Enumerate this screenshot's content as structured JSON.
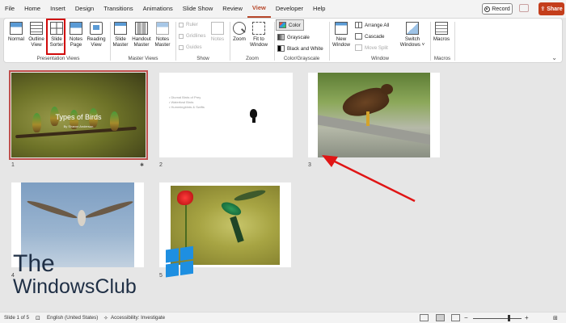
{
  "tabs": [
    "File",
    "Home",
    "Insert",
    "Design",
    "Transitions",
    "Animations",
    "Slide Show",
    "Review",
    "View",
    "Developer",
    "Help"
  ],
  "active_tab": "View",
  "header": {
    "record_label": "Record",
    "share_label": "Share"
  },
  "ribbon": {
    "presentation_views": {
      "label": "Presentation Views",
      "normal": "Normal",
      "outline": [
        "Outline",
        "View"
      ],
      "sorter": [
        "Slide",
        "Sorter"
      ],
      "notes": [
        "Notes",
        "Page"
      ],
      "reading": [
        "Reading",
        "View"
      ]
    },
    "master_views": {
      "label": "Master Views",
      "slide_master": [
        "Slide",
        "Master"
      ],
      "handout_master": [
        "Handout",
        "Master"
      ],
      "notes_master": [
        "Notes",
        "Master"
      ]
    },
    "show": {
      "label": "Show",
      "ruler": "Ruler",
      "gridlines": "Gridlines",
      "guides": "Guides",
      "notes": "Notes"
    },
    "zoom": {
      "label": "Zoom",
      "zoom": "Zoom",
      "fit": [
        "Fit to",
        "Window"
      ]
    },
    "color": {
      "label": "Color/Grayscale",
      "color": "Color",
      "grayscale": "Grayscale",
      "bw": "Black and White"
    },
    "window": {
      "label": "Window",
      "new_window": [
        "New",
        "Window"
      ],
      "arrange_all": "Arrange All",
      "cascade": "Cascade",
      "move_split": "Move Split",
      "switch": [
        "Switch",
        "Windows ˅"
      ]
    },
    "macros": {
      "label": "Macros",
      "macros": "Macros"
    }
  },
  "slides": [
    {
      "number": "1",
      "title": "Types of Birds",
      "subtitle": "By Sharon Anderson"
    },
    {
      "number": "2",
      "bullets": [
        "• Diurnal Birds of Prey",
        "• Waterfowl Birds",
        "• Hummingbirds & Swifts"
      ]
    },
    {
      "number": "3"
    },
    {
      "number": "4"
    },
    {
      "number": "5"
    }
  ],
  "watermark": {
    "line1": "The",
    "line2": "WindowsClub"
  },
  "status": {
    "slide_count": "Slide 1 of 5",
    "language": "English (United States)",
    "accessibility": "Accessibility: Investigate"
  },
  "colors": {
    "accent": "#b7472a",
    "share": "#c43e1c",
    "highlight": "#d10a0a",
    "arrow": "#e01515"
  }
}
